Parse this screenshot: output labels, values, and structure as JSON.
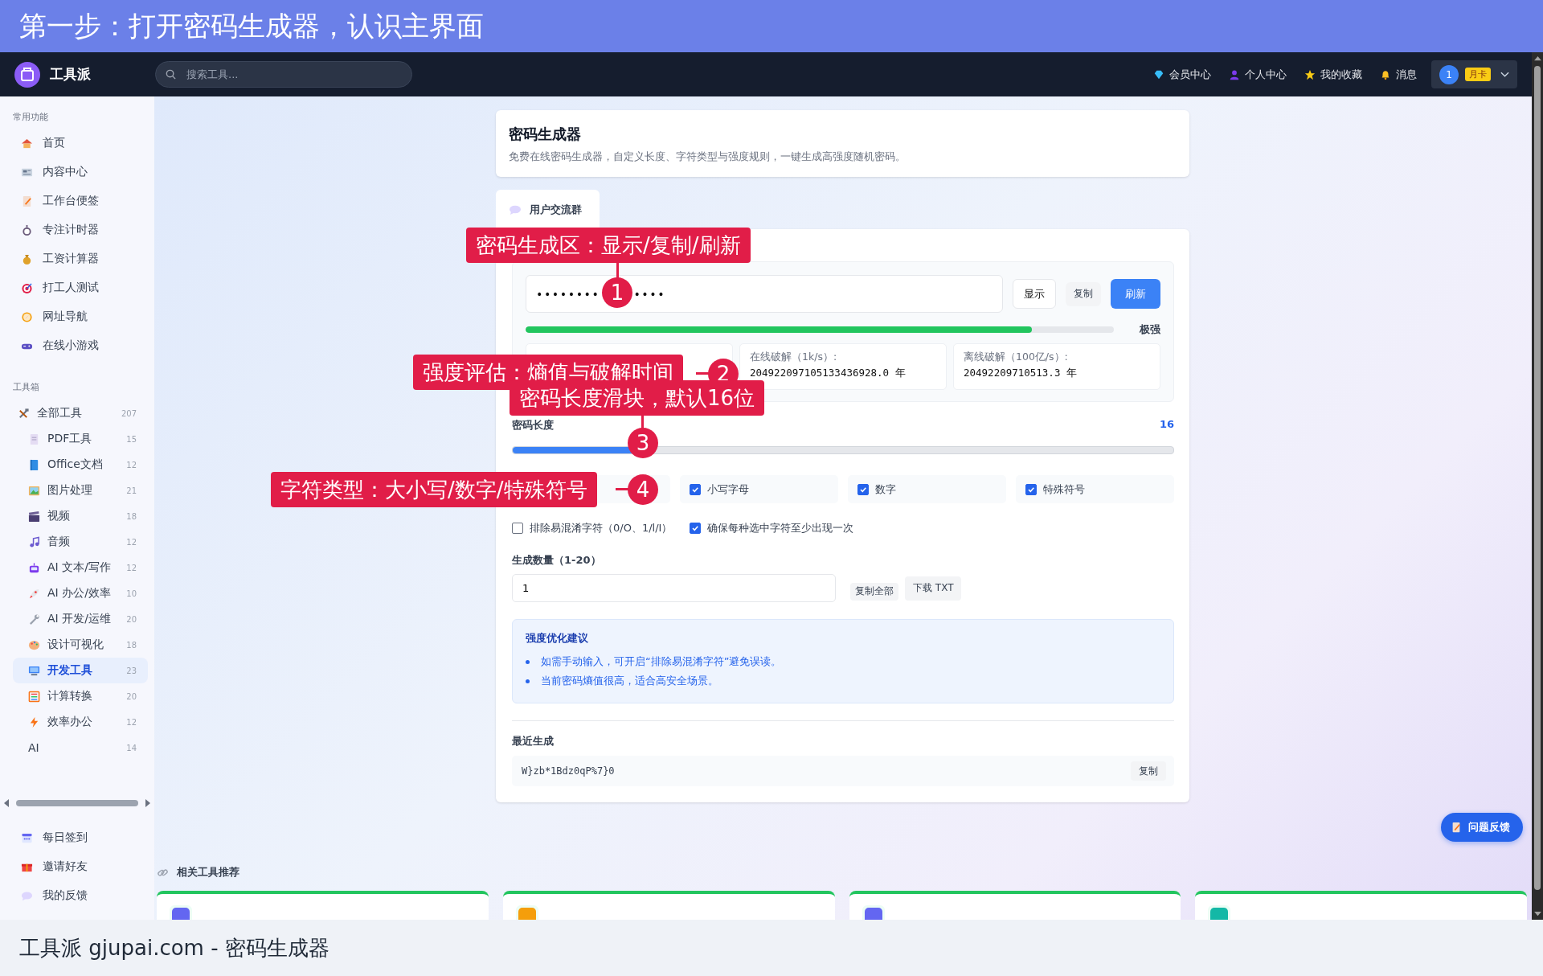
{
  "banner": {
    "title": "第一步：打开密码生成器，认识主界面"
  },
  "header": {
    "logo": "工具派",
    "search": {
      "placeholder": "搜索工具..."
    },
    "nav": [
      {
        "label": "会员中心"
      },
      {
        "label": "个人中心"
      },
      {
        "label": "我的收藏"
      },
      {
        "label": "消息"
      }
    ],
    "user": {
      "avatar": "1",
      "badge": "月卡"
    }
  },
  "sidebar": {
    "sections": [
      {
        "title": "常用功能",
        "items": [
          {
            "label": "首页",
            "selected": false
          },
          {
            "label": "内容中心",
            "selected": false
          },
          {
            "label": "工作台便签",
            "selected": false
          },
          {
            "label": "专注计时器",
            "selected": false
          },
          {
            "label": "工资计算器",
            "selected": false
          },
          {
            "label": "打工人测试",
            "selected": false
          },
          {
            "label": "网址导航",
            "selected": false
          },
          {
            "label": "在线小游戏",
            "selected": false
          }
        ]
      },
      {
        "title": "工具箱",
        "items": [
          {
            "label": "全部工具",
            "count": "207",
            "selected": false,
            "children": [
              {
                "label": "PDF工具",
                "count": "15",
                "selected": false
              },
              {
                "label": "Office文档",
                "count": "12",
                "selected": false
              },
              {
                "label": "图片处理",
                "count": "21",
                "selected": false
              },
              {
                "label": "视频",
                "count": "18",
                "selected": false
              },
              {
                "label": "音频",
                "count": "12",
                "selected": false
              },
              {
                "label": "AI 文本/写作",
                "count": "12",
                "selected": false
              },
              {
                "label": "AI 办公/效率",
                "count": "10",
                "selected": false
              },
              {
                "label": "AI 开发/运维",
                "count": "20",
                "selected": false
              },
              {
                "label": "设计可视化",
                "count": "18",
                "selected": false
              },
              {
                "label": "开发工具",
                "count": "23",
                "selected": true
              },
              {
                "label": "计算转换",
                "count": "20",
                "selected": false
              },
              {
                "label": "效率办公",
                "count": "12",
                "selected": false
              },
              {
                "label": "AI",
                "count": "14",
                "selected": false
              }
            ]
          }
        ]
      }
    ],
    "footer_items": [
      {
        "label": "每日签到"
      },
      {
        "label": "邀请好友"
      },
      {
        "label": "我的反馈"
      }
    ]
  },
  "page": {
    "title": "密码生成器",
    "subtitle": "免费在线密码生成器，自定义长度、字符类型与强度规则，一键生成高强度随机密码。",
    "tabs": [
      {
        "label": "用户交流群",
        "selected": true
      }
    ]
  },
  "generator": {
    "password": [
      "••••••••",
      "••••"
    ],
    "buttons": [
      {
        "label": "显示",
        "kind": "outline"
      },
      {
        "label": "复制",
        "kind": "plain"
      },
      {
        "label": "刷新",
        "kind": "primary"
      }
    ],
    "strength": {
      "level": 0.86,
      "label": "极强"
    },
    "stats": [
      {
        "label": "在线破解（1k/s）:",
        "value": "204922097105133436928.0 年"
      },
      {
        "label": "离线破解（100亿/s）:",
        "value": "20492209710513.3 年"
      }
    ],
    "length": {
      "label": "密码长度",
      "value": "16",
      "level": 0.2
    },
    "char_types": [
      {
        "label": "小写字母",
        "checked": true
      },
      {
        "label": "数字",
        "checked": true
      },
      {
        "label": "特殊符号",
        "checked": true
      }
    ],
    "rules": [
      {
        "label": "排除易混淆字符（0/O、1/l/I）",
        "checked": false
      },
      {
        "label": "确保每种选中字符至少出现一次",
        "checked": true
      }
    ],
    "count": {
      "label": "生成数量（1-20）",
      "value": "1",
      "buttons": [
        "复制全部",
        "下载 TXT"
      ]
    },
    "tips": {
      "title": "强度优化建议",
      "items": [
        "如需手动输入，可开启“排除易混淆字符”避免误读。",
        "当前密码熵值很高，适合高安全场景。"
      ]
    },
    "recent": {
      "title": "最近生成",
      "items": [
        {
          "value": "W}zb*1Bdz0qP%7}0",
          "action": "复制"
        }
      ]
    }
  },
  "related": {
    "title": "相关工具推荐",
    "cards": [
      {
        "color": "#6366f1"
      },
      {
        "color": "#f59e0b"
      },
      {
        "color": "#6366f1"
      },
      {
        "color": "#14b8a6"
      }
    ]
  },
  "feedback": {
    "label": "问题反馈"
  },
  "annotations": [
    {
      "number": "1",
      "text": "密码生成区：显示/复制/刷新"
    },
    {
      "number": "2",
      "text": "强度评估：熵值与破解时间"
    },
    {
      "number": "3",
      "text": "密码长度滑块，默认16位"
    },
    {
      "number": "4",
      "text": "字符类型：大小写/数字/特殊符号"
    }
  ],
  "caption": "工具派 gjupai.com - 密码生成器"
}
